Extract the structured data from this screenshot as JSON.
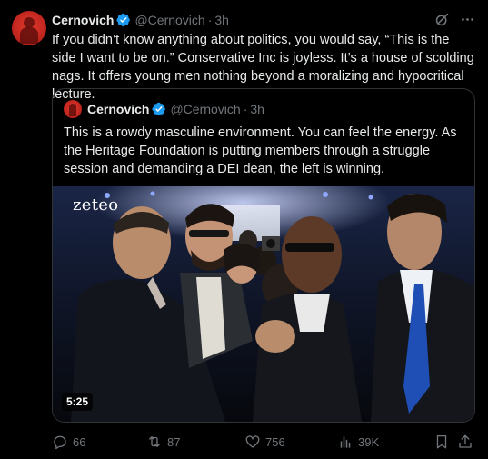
{
  "tweet": {
    "author_name": "Cernovich",
    "handle": "@Cernovich",
    "separator": "·",
    "time": "3h",
    "text": "If you didn’t know anything about politics, you would say, “This is the side I want to be on.” Conservative Inc is joyless. It’s a house of scolding nags. It offers young men nothing beyond a moralizing and hypocritical lecture."
  },
  "quoted_tweet": {
    "author_name": "Cernovich",
    "handle": "@Cernovich",
    "separator": "·",
    "time": "3h",
    "text": "This is a rowdy masculine environment. You can feel the energy. As the Heritage Foundation is putting members through a struggle session and demanding a DEI dean, the left is winning.",
    "video": {
      "watermark": "zeteo",
      "duration": "5:25"
    }
  },
  "actions": {
    "replies": "66",
    "reposts": "87",
    "likes": "756",
    "views": "39K"
  },
  "icons": {
    "verified": "verified-badge-icon",
    "grok": "grok-icon",
    "more": "more-icon",
    "reply": "reply-icon",
    "repost": "repost-icon",
    "like": "heart-icon",
    "views": "views-icon",
    "bookmark": "bookmark-icon",
    "share": "share-icon"
  },
  "colors": {
    "background": "#000000",
    "text": "#e7e9ea",
    "muted": "#71767b",
    "verified": "#1d9bf0",
    "border": "#2f3336"
  }
}
